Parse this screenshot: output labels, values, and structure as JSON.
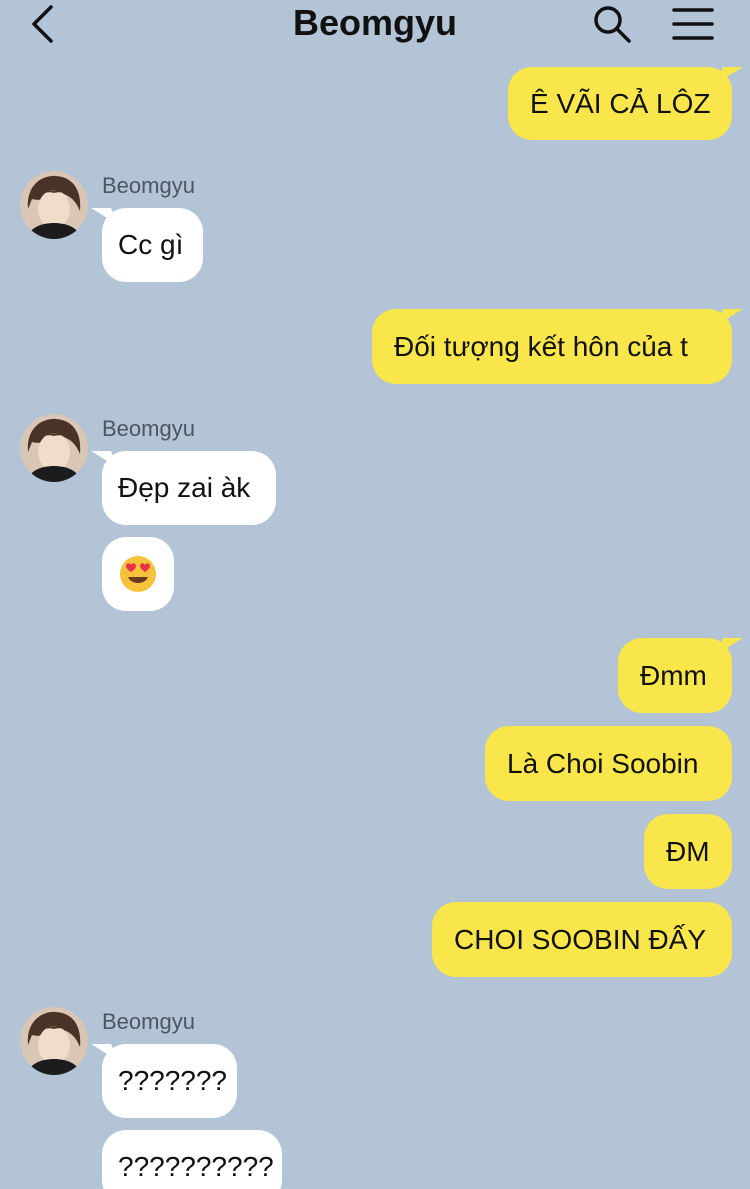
{
  "header": {
    "title": "Beomgyu",
    "back_icon": "chevron-left-icon",
    "search_icon": "search-icon",
    "menu_icon": "hamburger-menu-icon"
  },
  "colors": {
    "background": "#b2c4d6",
    "sent_bubble": "#f8e64a",
    "received_bubble": "#ffffff"
  },
  "messages": [
    {
      "from": "me",
      "text": "Ê VÃI CẢ LÔZ"
    },
    {
      "from": "Beomgyu",
      "sender": "Beomgyu",
      "text": "Cc gì"
    },
    {
      "from": "me",
      "text": "Đối tượng kết hôn của t"
    },
    {
      "from": "Beomgyu",
      "sender": "Beomgyu",
      "text": "Đẹp zai àk"
    },
    {
      "from": "Beomgyu",
      "text": "😍"
    },
    {
      "from": "me",
      "text": "Đmm"
    },
    {
      "from": "me",
      "text": "Là Choi Soobin"
    },
    {
      "from": "me",
      "text": "ĐM"
    },
    {
      "from": "me",
      "text": "CHOI SOOBIN ĐẤY"
    },
    {
      "from": "Beomgyu",
      "sender": "Beomgyu",
      "text": "???????"
    },
    {
      "from": "Beomgyu",
      "text": "??????????"
    }
  ]
}
